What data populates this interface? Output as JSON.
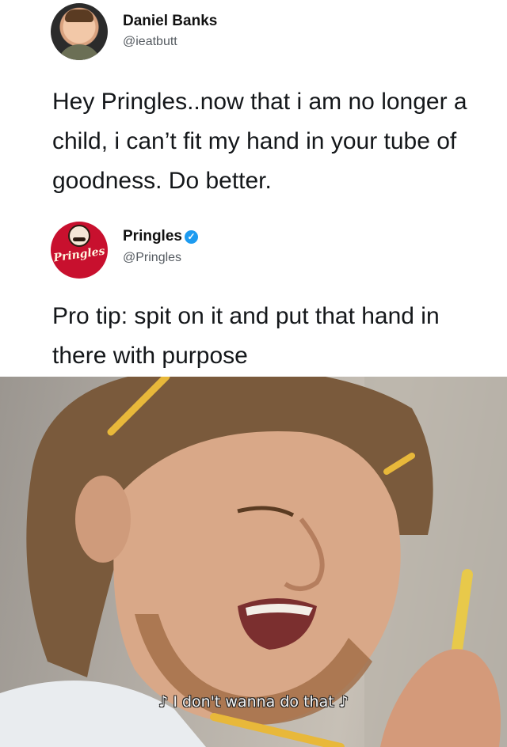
{
  "tweet1": {
    "name": "Daniel Banks",
    "handle": "@ieatbutt",
    "avatar_icon": "profile-photo",
    "text": "Hey Pringles..now that i am no longer a child, i can’t fit my hand in your tube of goodness. Do better."
  },
  "tweet2": {
    "name": "Pringles",
    "handle": "@Pringles",
    "avatar_icon": "pringles-logo",
    "logo_text": "Pringles",
    "verified_icon": "verified-badge-icon",
    "verified_glyph": "✓",
    "text": "Pro tip: spit on it and put that hand in there with purpose"
  },
  "meme": {
    "caption": "♪ I don't wanna do that ♪",
    "colors": {
      "hair": "#7a5a3c",
      "skin": "#d9a888",
      "pencil": "#e8b83a",
      "shirt": "#e9ecef"
    }
  }
}
